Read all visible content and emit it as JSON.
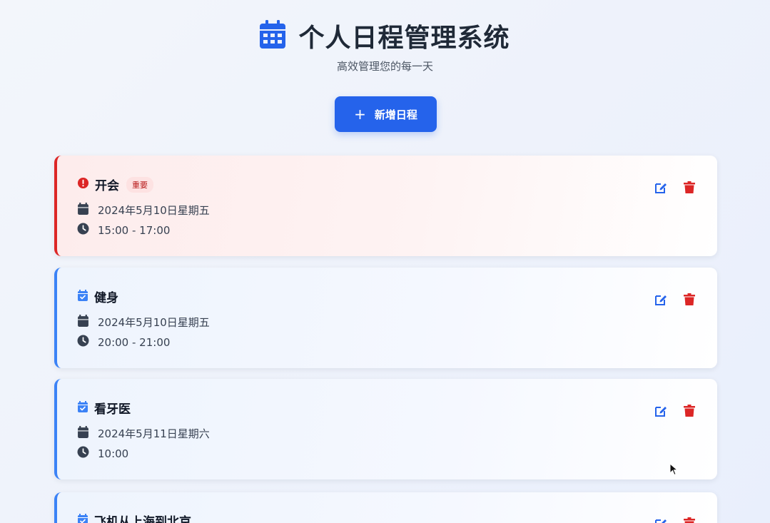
{
  "header": {
    "title": "个人日程管理系统",
    "subtitle": "高效管理您的每一天",
    "icon": "calendar-icon"
  },
  "toolbar": {
    "add_label": "新增日程"
  },
  "schedules": [
    {
      "title": "开会",
      "important": true,
      "badge": "重要",
      "date": "2024年5月10日星期五",
      "time": "15:00 - 17:00"
    },
    {
      "title": "健身",
      "important": false,
      "date": "2024年5月10日星期五",
      "time": "20:00 - 21:00"
    },
    {
      "title": "看牙医",
      "important": false,
      "date": "2024年5月11日星期六",
      "time": "10:00"
    },
    {
      "title": "飞机从上海到北京",
      "important": false
    }
  ],
  "colors": {
    "accent": "#2563eb",
    "danger": "#dc2626",
    "normal_border": "#3b82f6",
    "important_border": "#dc2626"
  }
}
